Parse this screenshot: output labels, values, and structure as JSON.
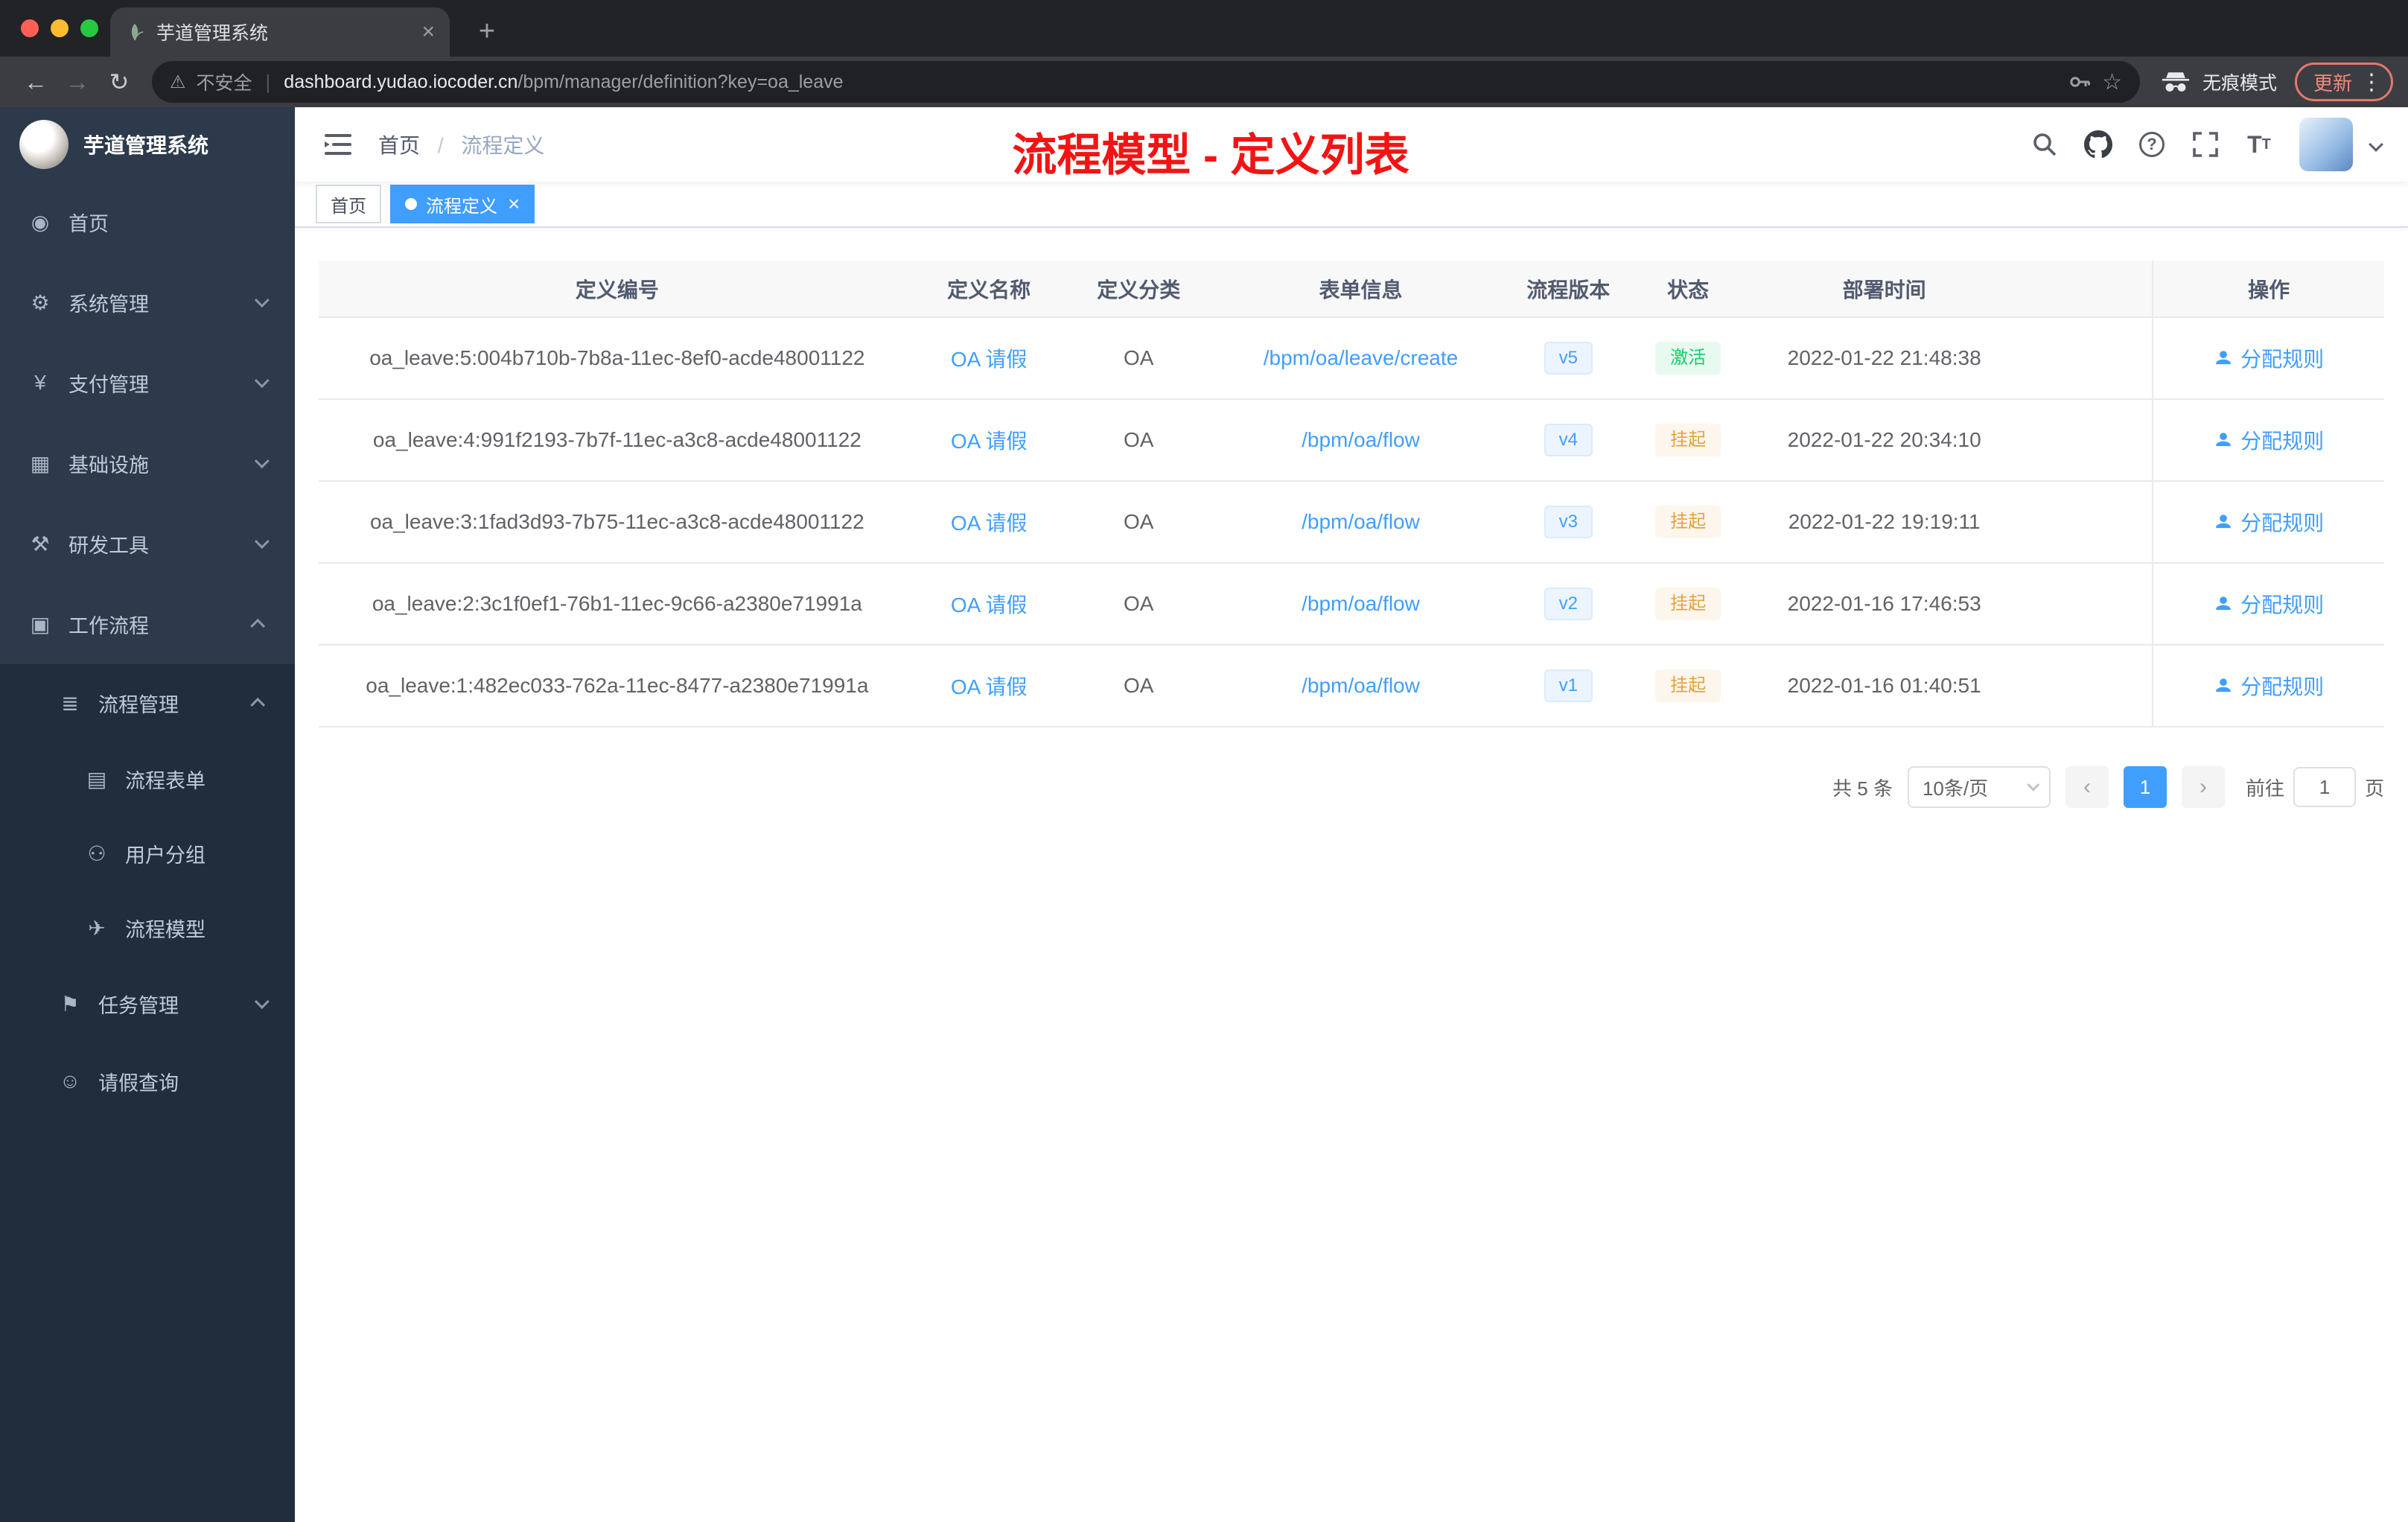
{
  "colors": {
    "accent_blue": "#409eff",
    "success_green": "#13ce66",
    "warning_orange": "#e6a23c",
    "annotation_red": "#f21414",
    "sidebar_dark": "#1f2d3d",
    "sidebar_base": "#2d3a4b"
  },
  "browser": {
    "tab_title": "芋道管理系统",
    "security_label": "不安全",
    "url_host": "dashboard.yudao.iocoder.cn",
    "url_path": "/bpm/manager/definition?key=oa_leave",
    "incognito_label": "无痕模式",
    "update_label": "更新"
  },
  "sidebar": {
    "app_title": "芋道管理系统",
    "items": [
      {
        "key": "home",
        "label": "首页",
        "icon": "dashboard",
        "level": 0,
        "chevron": "none"
      },
      {
        "key": "system-mgmt",
        "label": "系统管理",
        "icon": "gear",
        "level": 0,
        "chevron": "down"
      },
      {
        "key": "payment-mgmt",
        "label": "支付管理",
        "icon": "yen",
        "level": 0,
        "chevron": "down"
      },
      {
        "key": "infrastructure",
        "label": "基础设施",
        "icon": "infra",
        "level": 0,
        "chevron": "down"
      },
      {
        "key": "dev-tools",
        "label": "研发工具",
        "icon": "tools",
        "level": 0,
        "chevron": "down"
      },
      {
        "key": "workflow",
        "label": "工作流程",
        "icon": "workflow",
        "level": 0,
        "chevron": "up"
      },
      {
        "key": "process-mgmt",
        "label": "流程管理",
        "icon": "list",
        "level": 1,
        "chevron": "up"
      },
      {
        "key": "process-form",
        "label": "流程表单",
        "icon": "form",
        "level": 2,
        "chevron": "none"
      },
      {
        "key": "user-group",
        "label": "用户分组",
        "icon": "users",
        "level": 2,
        "chevron": "none"
      },
      {
        "key": "process-model",
        "label": "流程模型",
        "icon": "send",
        "level": 2,
        "chevron": "none"
      },
      {
        "key": "task-mgmt",
        "label": "任务管理",
        "icon": "tasks",
        "level": 1,
        "chevron": "down"
      },
      {
        "key": "leave-query",
        "label": "请假查询",
        "icon": "person",
        "level": 1,
        "chevron": "none"
      }
    ]
  },
  "navbar": {
    "breadcrumb_home": "首页",
    "breadcrumb_sep": "/",
    "breadcrumb_current": "流程定义",
    "annotation": "流程模型 - 定义列表"
  },
  "tags_view": {
    "tags": [
      {
        "label": "首页",
        "active": false
      },
      {
        "label": "流程定义",
        "active": true
      }
    ]
  },
  "table": {
    "headers": [
      "定义编号",
      "定义名称",
      "定义分类",
      "表单信息",
      "流程版本",
      "状态",
      "部署时间",
      "操作"
    ],
    "action_label": "分配规则",
    "rows": [
      {
        "id": "oa_leave:5:004b710b-7b8a-11ec-8ef0-acde48001122",
        "name": "OA 请假",
        "category": "OA",
        "form": "/bpm/oa/leave/create",
        "version": "v5",
        "status": "激活",
        "status_type": "success",
        "time": "2022-01-22 21:48:38"
      },
      {
        "id": "oa_leave:4:991f2193-7b7f-11ec-a3c8-acde48001122",
        "name": "OA 请假",
        "category": "OA",
        "form": "/bpm/oa/flow",
        "version": "v4",
        "status": "挂起",
        "status_type": "warning",
        "time": "2022-01-22 20:34:10"
      },
      {
        "id": "oa_leave:3:1fad3d93-7b75-11ec-a3c8-acde48001122",
        "name": "OA 请假",
        "category": "OA",
        "form": "/bpm/oa/flow",
        "version": "v3",
        "status": "挂起",
        "status_type": "warning",
        "time": "2022-01-22 19:19:11"
      },
      {
        "id": "oa_leave:2:3c1f0ef1-76b1-11ec-9c66-a2380e71991a",
        "name": "OA 请假",
        "category": "OA",
        "form": "/bpm/oa/flow",
        "version": "v2",
        "status": "挂起",
        "status_type": "warning",
        "time": "2022-01-16 17:46:53"
      },
      {
        "id": "oa_leave:1:482ec033-762a-11ec-8477-a2380e71991a",
        "name": "OA 请假",
        "category": "OA",
        "form": "/bpm/oa/flow",
        "version": "v1",
        "status": "挂起",
        "status_type": "warning",
        "time": "2022-01-16 01:40:51"
      }
    ]
  },
  "pagination": {
    "total": "共 5 条",
    "page_size": "10条/页",
    "current_page": "1",
    "goto_prefix": "前往",
    "goto_value": "1",
    "goto_suffix": "页"
  }
}
